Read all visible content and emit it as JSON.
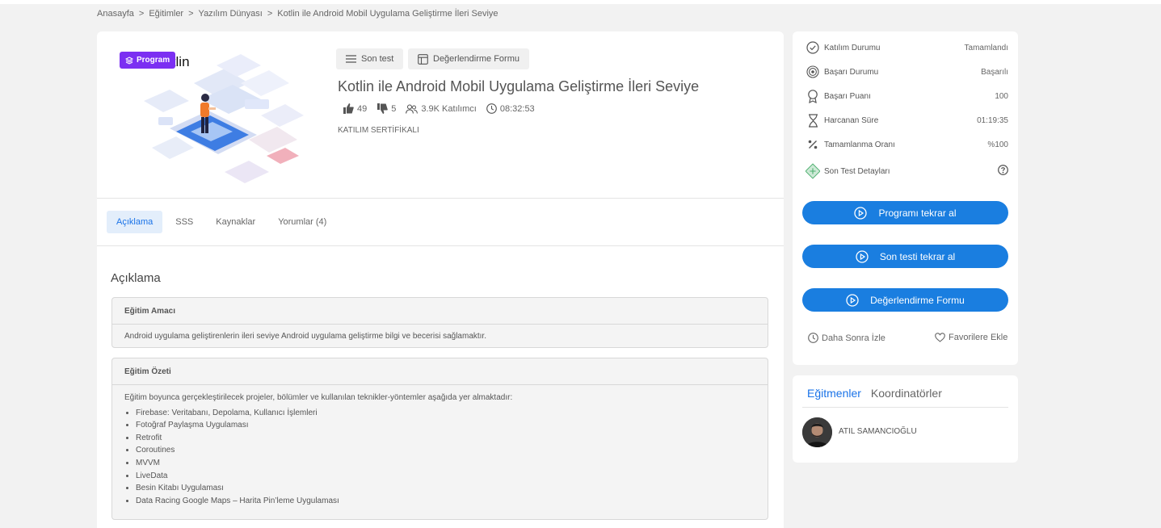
{
  "breadcrumb": {
    "items": [
      "Anasayfa",
      "Eğitimler",
      "Yazılım Dünyası",
      "Kotlin ile Android Mobil Uygulama Geliştirme İleri Seviye"
    ],
    "separator": ">"
  },
  "course": {
    "badge": "Program",
    "image_label": "Kotlin",
    "actions": {
      "last_test": "Son test",
      "evaluation_form": "Değerlendirme Formu"
    },
    "title": "Kotlin ile Android Mobil Uygulama Geliştirme İleri Seviye",
    "likes": "49",
    "dislikes": "5",
    "participants": "3.9K Katılımcı",
    "duration": "08:32:53",
    "certificate": "KATILIM SERTİFİKALI"
  },
  "tabs": [
    {
      "label": "Açıklama",
      "active": true
    },
    {
      "label": "SSS",
      "active": false
    },
    {
      "label": "Kaynaklar",
      "active": false
    },
    {
      "label": "Yorumlar (4)",
      "active": false
    }
  ],
  "description": {
    "heading": "Açıklama",
    "purpose": {
      "title": "Eğitim Amacı",
      "text": "Android uygulama geliştirenlerin ileri seviye Android uygulama geliştirme bilgi ve becerisi sağlamaktır."
    },
    "summary": {
      "title": "Eğitim Özeti",
      "intro": "Eğitim boyunca gerçekleştirilecek projeler, bölümler ve kullanılan teknikler-yöntemler aşağıda yer almaktadır:",
      "items": [
        "Firebase: Veritabanı, Depolama, Kullanıcı İşlemleri",
        "Fotoğraf Paylaşma Uygulaması",
        "Retrofit",
        "Coroutines",
        "MVVM",
        "LiveData",
        "Besin Kitabı Uygulaması",
        "Data Racing Google Maps – Harita Pin’leme Uygulaması"
      ]
    }
  },
  "stats": {
    "participation": {
      "label": "Katılım Durumu",
      "value": "Tamamlandı"
    },
    "success": {
      "label": "Başarı Durumu",
      "value": "Başarılı"
    },
    "score": {
      "label": "Başarı Puanı",
      "value": "100"
    },
    "time_spent": {
      "label": "Harcanan Süre",
      "value": "01:19:35"
    },
    "completion": {
      "label": "Tamamlanma Oranı",
      "value": "%100"
    },
    "last_test_details": {
      "label": "Son Test Detayları"
    }
  },
  "buttons": {
    "retake_program": "Programı tekrar al",
    "retake_last_test": "Son testi tekrar al",
    "evaluation_form": "Değerlendirme Formu",
    "watch_later": "Daha Sonra İzle",
    "add_favorites": "Favorilere Ekle"
  },
  "team": {
    "tab_instructors": "Eğitmenler",
    "tab_coordinators": "Koordinatörler",
    "instructor_name": "ATIL SAMANCIOĞLU"
  },
  "colors": {
    "accent": "#1a7ee0",
    "badge": "#7b2ff2",
    "active_tab_bg": "#e3eefb"
  }
}
